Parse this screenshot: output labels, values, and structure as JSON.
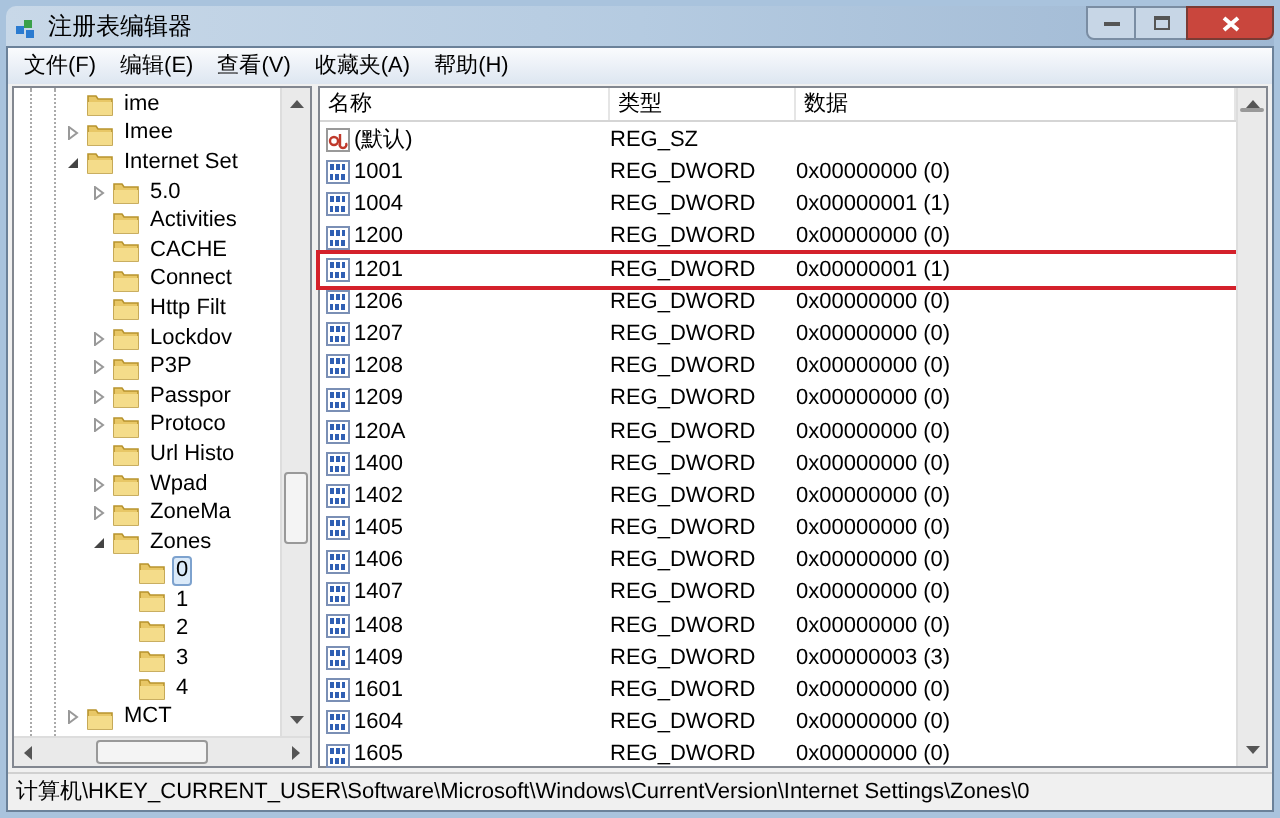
{
  "window": {
    "title": "注册表编辑器"
  },
  "menu": [
    "文件(F)",
    "编辑(E)",
    "查看(V)",
    "收藏夹(A)",
    "帮助(H)"
  ],
  "tree": [
    {
      "label": "ime",
      "kind": "leaf",
      "selected": false
    },
    {
      "label": "Imee",
      "kind": "collapsed",
      "selected": false
    },
    {
      "label": "Internet Set",
      "kind": "expanded",
      "selected": false,
      "children": [
        {
          "label": "5.0",
          "kind": "collapsed",
          "selected": false
        },
        {
          "label": "Activities",
          "kind": "leaf",
          "selected": false
        },
        {
          "label": "CACHE",
          "kind": "leaf",
          "selected": false
        },
        {
          "label": "Connect",
          "kind": "leaf",
          "selected": false
        },
        {
          "label": "Http Filt",
          "kind": "leaf",
          "selected": false
        },
        {
          "label": "Lockdov",
          "kind": "collapsed",
          "selected": false
        },
        {
          "label": "P3P",
          "kind": "collapsed",
          "selected": false
        },
        {
          "label": "Passpor",
          "kind": "collapsed",
          "selected": false
        },
        {
          "label": "Protoco",
          "kind": "collapsed",
          "selected": false
        },
        {
          "label": "Url Histo",
          "kind": "leaf",
          "selected": false
        },
        {
          "label": "Wpad",
          "kind": "collapsed",
          "selected": false
        },
        {
          "label": "ZoneMa",
          "kind": "collapsed",
          "selected": false
        },
        {
          "label": "Zones",
          "kind": "expanded",
          "selected": false,
          "children": [
            {
              "label": "0",
              "kind": "leaf",
              "selected": true
            },
            {
              "label": "1",
              "kind": "leaf",
              "selected": false
            },
            {
              "label": "2",
              "kind": "leaf",
              "selected": false
            },
            {
              "label": "3",
              "kind": "leaf",
              "selected": false
            },
            {
              "label": "4",
              "kind": "leaf",
              "selected": false
            }
          ]
        }
      ]
    },
    {
      "label": "MCT",
      "kind": "collapsed",
      "selected": false
    }
  ],
  "table": {
    "columns": [
      "名称",
      "类型",
      "数据"
    ],
    "rows": [
      {
        "kind": "string",
        "name": "(默认)",
        "type": "REG_SZ",
        "data": "",
        "highlighted": false
      },
      {
        "kind": "dword",
        "name": "1001",
        "type": "REG_DWORD",
        "data": "0x00000000 (0)",
        "highlighted": false
      },
      {
        "kind": "dword",
        "name": "1004",
        "type": "REG_DWORD",
        "data": "0x00000001 (1)",
        "highlighted": false
      },
      {
        "kind": "dword",
        "name": "1200",
        "type": "REG_DWORD",
        "data": "0x00000000 (0)",
        "highlighted": false
      },
      {
        "kind": "dword",
        "name": "1201",
        "type": "REG_DWORD",
        "data": "0x00000001 (1)",
        "highlighted": true
      },
      {
        "kind": "dword",
        "name": "1206",
        "type": "REG_DWORD",
        "data": "0x00000000 (0)",
        "highlighted": false
      },
      {
        "kind": "dword",
        "name": "1207",
        "type": "REG_DWORD",
        "data": "0x00000000 (0)",
        "highlighted": false
      },
      {
        "kind": "dword",
        "name": "1208",
        "type": "REG_DWORD",
        "data": "0x00000000 (0)",
        "highlighted": false
      },
      {
        "kind": "dword",
        "name": "1209",
        "type": "REG_DWORD",
        "data": "0x00000000 (0)",
        "highlighted": false
      },
      {
        "kind": "dword",
        "name": "120A",
        "type": "REG_DWORD",
        "data": "0x00000000 (0)",
        "highlighted": false
      },
      {
        "kind": "dword",
        "name": "1400",
        "type": "REG_DWORD",
        "data": "0x00000000 (0)",
        "highlighted": false
      },
      {
        "kind": "dword",
        "name": "1402",
        "type": "REG_DWORD",
        "data": "0x00000000 (0)",
        "highlighted": false
      },
      {
        "kind": "dword",
        "name": "1405",
        "type": "REG_DWORD",
        "data": "0x00000000 (0)",
        "highlighted": false
      },
      {
        "kind": "dword",
        "name": "1406",
        "type": "REG_DWORD",
        "data": "0x00000000 (0)",
        "highlighted": false
      },
      {
        "kind": "dword",
        "name": "1407",
        "type": "REG_DWORD",
        "data": "0x00000000 (0)",
        "highlighted": false
      },
      {
        "kind": "dword",
        "name": "1408",
        "type": "REG_DWORD",
        "data": "0x00000000 (0)",
        "highlighted": false
      },
      {
        "kind": "dword",
        "name": "1409",
        "type": "REG_DWORD",
        "data": "0x00000003 (3)",
        "highlighted": false
      },
      {
        "kind": "dword",
        "name": "1601",
        "type": "REG_DWORD",
        "data": "0x00000000 (0)",
        "highlighted": false
      },
      {
        "kind": "dword",
        "name": "1604",
        "type": "REG_DWORD",
        "data": "0x00000000 (0)",
        "highlighted": false
      },
      {
        "kind": "dword",
        "name": "1605",
        "type": "REG_DWORD",
        "data": "0x00000000 (0)",
        "highlighted": false
      }
    ]
  },
  "status_bar": "计算机\\HKEY_CURRENT_USER\\Software\\Microsoft\\Windows\\CurrentVersion\\Internet Settings\\Zones\\0"
}
